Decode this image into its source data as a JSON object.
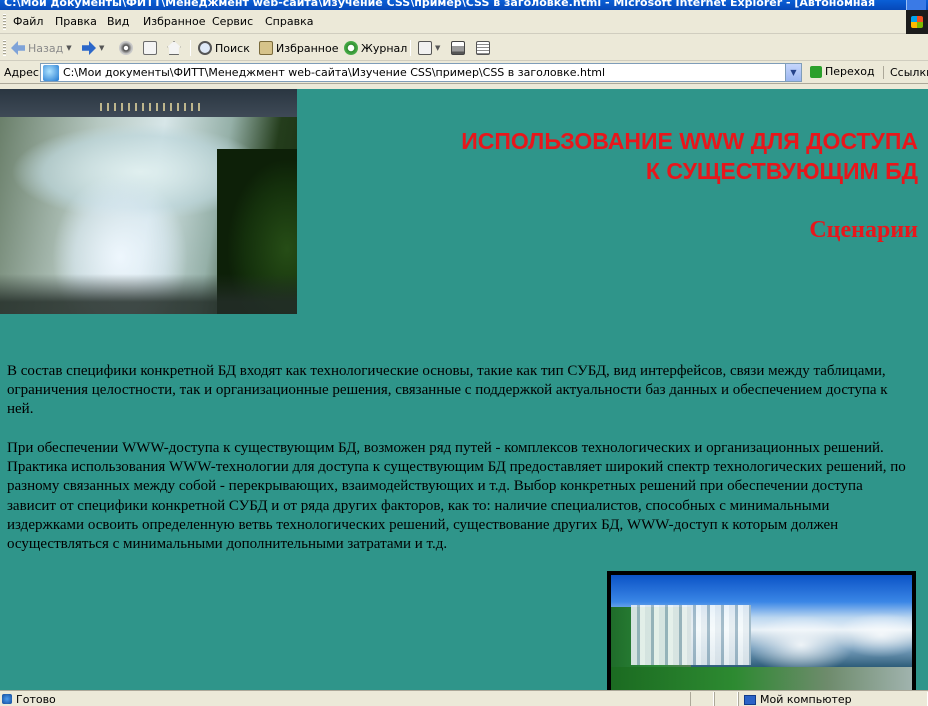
{
  "window": {
    "title": "C:\\Мои документы\\ФИТТ\\Менеджмент web-сайта\\Изучение CSS\\пример\\CSS в заголовке.html - Microsoft Internet Explorer - [Автономная"
  },
  "menu": {
    "items": [
      "Файл",
      "Правка",
      "Вид",
      "Избранное",
      "Сервис",
      "Справка"
    ]
  },
  "toolbar": {
    "back_label": "Назад",
    "search_label": "Поиск",
    "favorites_label": "Избранное",
    "history_label": "Журнал"
  },
  "address": {
    "label": "Адрес",
    "url": "C:\\Мои документы\\ФИТТ\\Менеджмент web-сайта\\Изучение CSS\\пример\\CSS в заголовке.html",
    "go_label": "Переход",
    "links_label": "Ссылки"
  },
  "page": {
    "heading_line1": "ИСПОЛЬЗОВАНИЕ WWW ДЛЯ ДОСТУПА",
    "heading_line2": "К СУЩЕСТВУЮЩИМ БД",
    "subheading": "Сценарии",
    "paragraph1": "В состав специфики конкретной БД входят как технологические основы, такие как тип СУБД, вид интерфейсов, связи между таблицами, ограничения целостности, так и организационные решения, связанные с поддержкой актуальности баз данных и обеспечением доступа к ней.",
    "paragraph2": "При обеспечении WWW-доступа к существующим БД, возможен ряд путей - комплексов технологических и организационных решений. Практика использования WWW-технологии для доступа к существующим БД предоставляет широкий спектр технологических решений, по разному связанных между собой - перекрывающих, взаимодействующих и т.д. Выбор конкретных решений при обеспечении доступа зависит от специфики конкретной СУБД и от ряда других факторов, как то: наличие специалистов, способных с минимальными издержками освоить определенную ветвь технологических решений, существование других БД, WWW-доступ к которым должен осуществляться с минимальными дополнительными затратами и т.д.",
    "background_color": "#2f958a",
    "heading_color": "#e8161b"
  },
  "status": {
    "text": "Готово",
    "zone": "Мой компьютер"
  }
}
